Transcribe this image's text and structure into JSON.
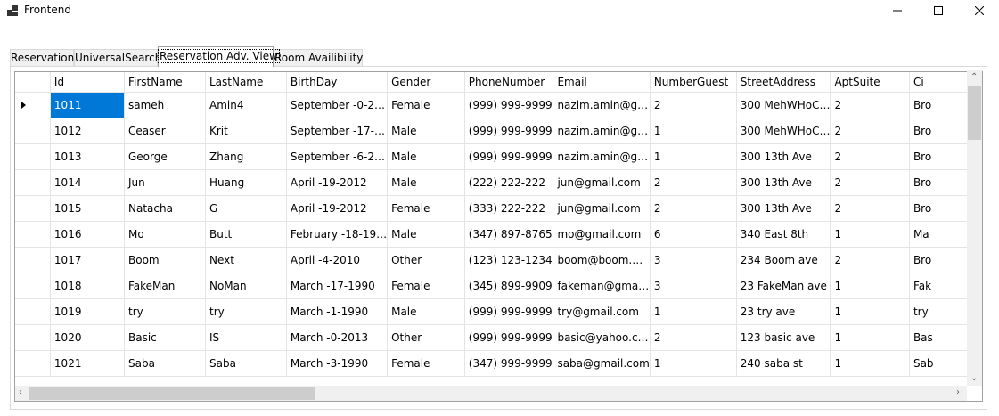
{
  "window": {
    "title": "Frontend"
  },
  "tabs": [
    {
      "label": "Reservation",
      "active": false
    },
    {
      "label": "UniversalSearch",
      "active": false
    },
    {
      "label": "Reservation Adv. View",
      "active": true
    },
    {
      "label": "Room Availibility",
      "active": false
    }
  ],
  "grid": {
    "columns": [
      "Id",
      "FirstName",
      "LastName",
      "BirthDay",
      "Gender",
      "PhoneNumber",
      "Email",
      "NumberGuest",
      "StreetAddress",
      "AptSuite",
      "Ci"
    ],
    "rows": [
      [
        "1011",
        "sameh",
        "Amin4",
        "September -0-2…",
        "Female",
        "(999) 999-9999",
        "nazim.amin@g…",
        "2",
        "300 MehWHoC…",
        "2",
        "Bro"
      ],
      [
        "1012",
        "Ceaser",
        "Krit",
        "September -17-…",
        "Male",
        "(999) 999-9999",
        "nazim.amin@g…",
        "1",
        "300 MehWHoC…",
        "2",
        "Bro"
      ],
      [
        "1013",
        "George",
        "Zhang",
        "September -6-2…",
        "Male",
        "(999) 999-9999",
        "nazim.amin@g…",
        "1",
        "300 13th Ave",
        "2",
        "Bro"
      ],
      [
        "1014",
        "Jun",
        "Huang",
        "April -19-2012",
        "Male",
        "(222) 222-222",
        "jun@gmail.com",
        "2",
        "300 13th Ave",
        "2",
        "Bro"
      ],
      [
        "1015",
        "Natacha",
        "G",
        "April -19-2012",
        "Female",
        "(333) 222-222",
        "jun@gmail.com",
        "2",
        "300 13th Ave",
        "2",
        "Bro"
      ],
      [
        "1016",
        "Mo",
        "Butt",
        "February -18-19…",
        "Male",
        "(347) 897-8765",
        "mo@gmail.com",
        "6",
        "340 East 8th",
        "1",
        "Ma"
      ],
      [
        "1017",
        "Boom",
        "Next",
        "April -4-2010",
        "Other",
        "(123) 123-1234",
        "boom@boom.…",
        "3",
        "234 Boom ave",
        "2",
        "Bro"
      ],
      [
        "1018",
        "FakeMan",
        "NoMan",
        "March -17-1990",
        "Female",
        "(345) 899-9909",
        "fakeman@gma…",
        "3",
        "23 FakeMan ave",
        "1",
        "Fak"
      ],
      [
        "1019",
        "try",
        "try",
        "March -1-1990",
        "Male",
        "(999) 999-9999",
        "try@gmail.com",
        "1",
        "23 try ave",
        "1",
        "try"
      ],
      [
        "1020",
        "Basic",
        "IS",
        "March -0-2013",
        "Other",
        "(999) 999-9999",
        "basic@yahoo.c…",
        "2",
        "123 basic ave",
        "1",
        "Bas"
      ],
      [
        "1021",
        "Saba",
        "Saba",
        "March -3-1990",
        "Female",
        "(347) 999-9999",
        "saba@gmail.com",
        "1",
        "240 saba st",
        "1",
        "Sab"
      ]
    ]
  },
  "colors": {
    "selection": "#0078d7",
    "gridline": "#e4e4e4"
  }
}
